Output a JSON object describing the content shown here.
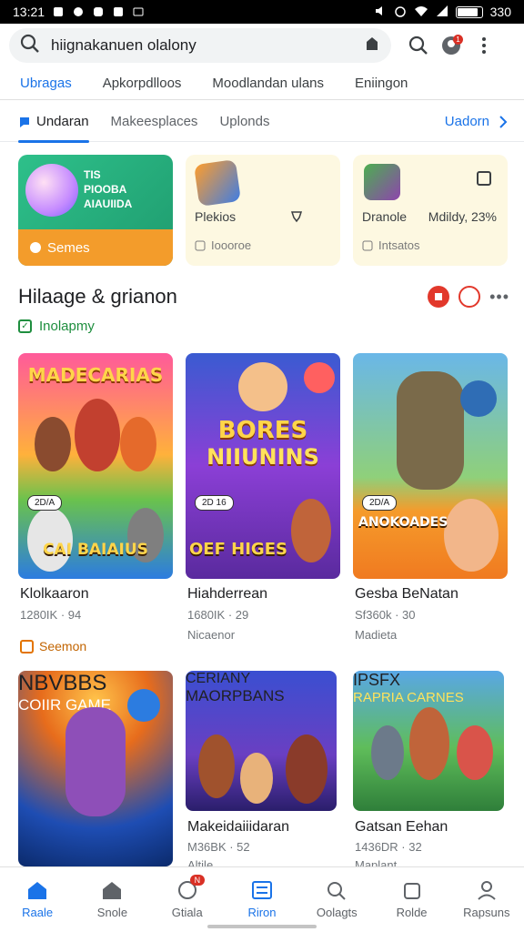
{
  "status_bar": {
    "time": "13:21",
    "battery": "330",
    "battery_level": 0.8
  },
  "search": {
    "query": "hiignakanuen olalony"
  },
  "top_tabs": [
    {
      "label": "Ubragas",
      "active": true
    },
    {
      "label": "Apkorpdlloos",
      "active": false
    },
    {
      "label": "Moodlandan ulans",
      "active": false
    },
    {
      "label": "Eniingon",
      "active": false
    }
  ],
  "sub_tabs": [
    {
      "label": "Undaran",
      "active": true
    },
    {
      "label": "Makeesplaces",
      "active": false
    },
    {
      "label": "Uplonds",
      "active": false
    }
  ],
  "sub_link": "Uadorn",
  "promos": [
    {
      "lines": [
        "TIS",
        "PIOOBA",
        "AIAUIIDA"
      ],
      "bottom": "Semes"
    },
    {
      "name": "Plekios",
      "sub": "Ioooroe"
    },
    {
      "name": "Dranole",
      "tag": "Mdildy, 23%",
      "sub": "Intsatos"
    }
  ],
  "section": {
    "title": "Hilaage & grianon",
    "chip": "Inolapmy"
  },
  "games_row1": [
    {
      "art_title": "MADECARIAS",
      "art_sub": "CAI BAIAIUS",
      "badge": "2D/A",
      "name": "Klolkaaron",
      "meta": "1280IK · 94",
      "meta2": ""
    },
    {
      "art_title": "BORES",
      "art_title2": "NIIUNINS",
      "art_sub": "OEF HIGES",
      "badge": "2D 16",
      "name": "Hiahderrean",
      "meta": "1680IK · 29",
      "meta2": "Nicaenor"
    },
    {
      "art_title": "",
      "art_sub": "ANOKOADES",
      "badge": "2D/A",
      "name": "Gesba BeNatan",
      "meta": "Sf360k · 30",
      "meta2": "Madieta"
    }
  ],
  "row1_chip": "Seemon",
  "games_row2": [
    {
      "art_title": "NBVBBS",
      "art_sub": "COIIR GAME",
      "name": "",
      "meta": "",
      "meta2": ""
    },
    {
      "art_title": "CERIANY",
      "art_title2": "MAORPBANS",
      "name": "Makeidaiiidaran",
      "meta": "M36BK · 52",
      "meta2": "Altile"
    },
    {
      "art_title": "IPSFX",
      "art_sub": "RAPRIA CARNES",
      "name": "Gatsan Eehan",
      "meta": "1436DR · 32",
      "meta2": "Maplant"
    }
  ],
  "bottom_nav": [
    {
      "label": "Raale",
      "icon": "home-icon",
      "active": true
    },
    {
      "label": "Snole",
      "icon": "store-icon",
      "active": false
    },
    {
      "label": "Gtiala",
      "icon": "face-icon",
      "active": false,
      "badge": "N"
    },
    {
      "label": "Riron",
      "icon": "list-icon",
      "active": true
    },
    {
      "label": "Oolagts",
      "icon": "search-icon",
      "active": false
    },
    {
      "label": "Rolde",
      "icon": "bag-icon",
      "active": false
    },
    {
      "label": "Rapsuns",
      "icon": "person-icon",
      "active": false
    }
  ]
}
